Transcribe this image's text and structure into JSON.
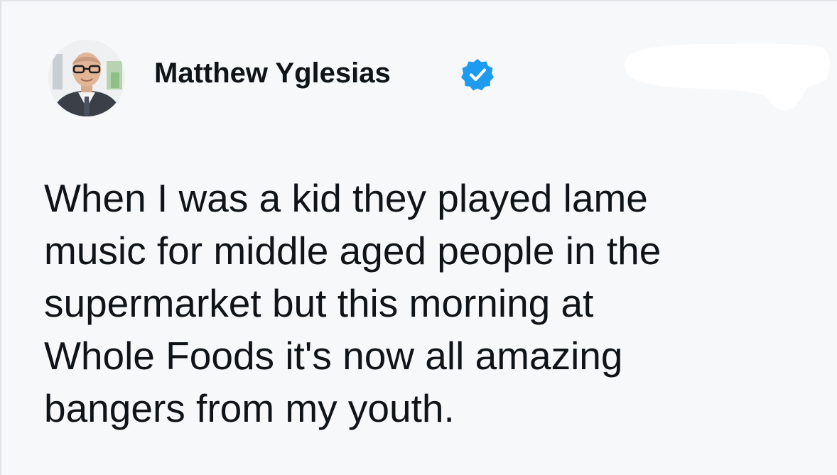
{
  "author": {
    "name": "Matthew Yglesias",
    "avatar_icon": "profile-photo",
    "verified_icon": "verified-badge-icon",
    "verified_color": "#1d9bf0"
  },
  "tweet": {
    "lines": [
      "When I was a kid they played lame",
      "music for middle aged people in the",
      "supermarket but this morning at",
      "Whole Foods it's now all amazing",
      "bangers from my youth."
    ]
  },
  "colors": {
    "background": "#f7f8fa",
    "text": "#0f1419",
    "redaction": "#ffffff"
  }
}
